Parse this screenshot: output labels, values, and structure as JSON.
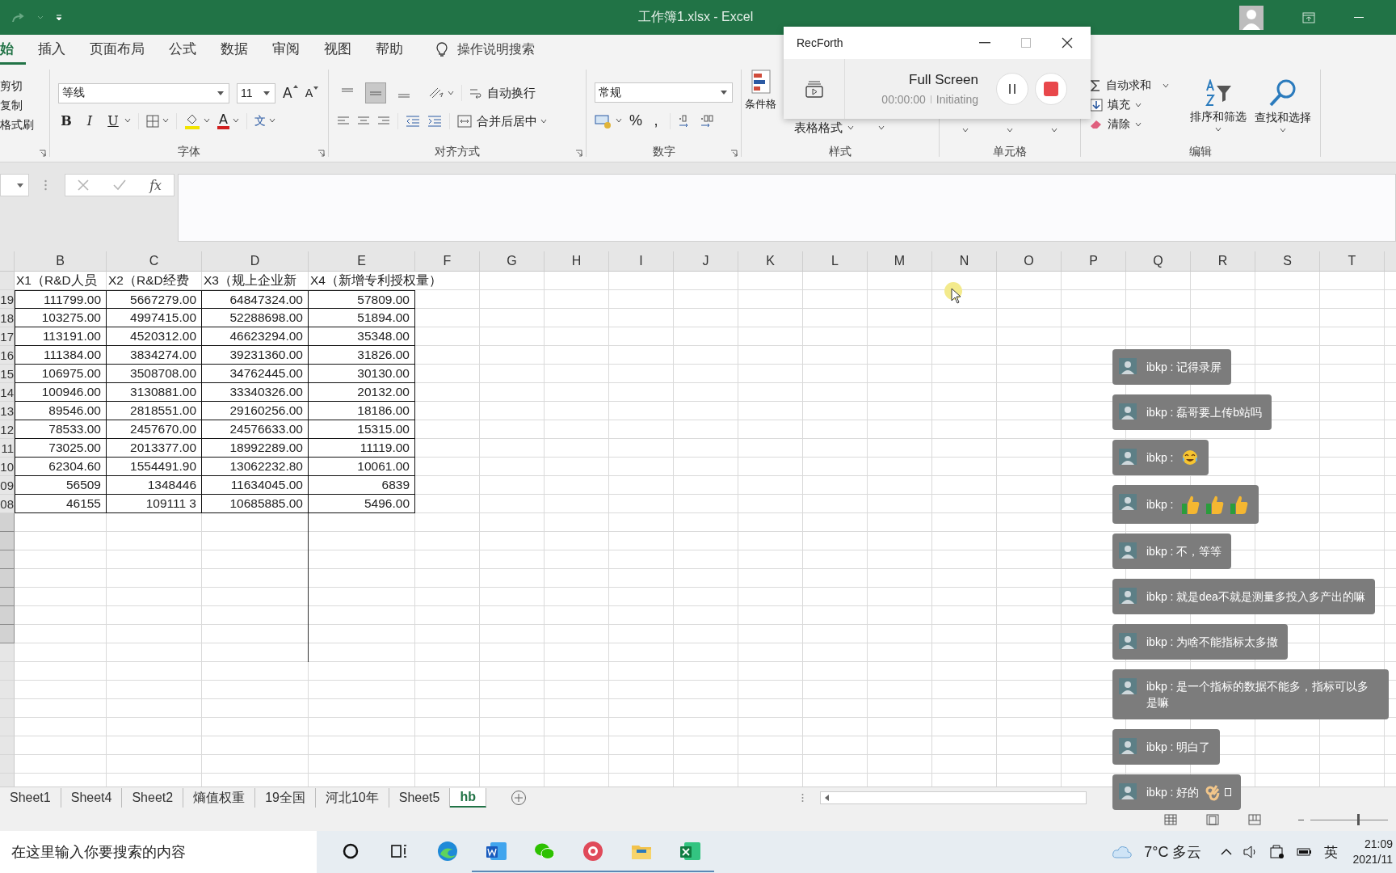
{
  "window": {
    "title": "工作簿1.xlsx  -  Excel"
  },
  "ribbon_tabs": [
    {
      "label": "始",
      "selected": true
    },
    {
      "label": "插入",
      "selected": false
    },
    {
      "label": "页面布局",
      "selected": false
    },
    {
      "label": "公式",
      "selected": false
    },
    {
      "label": "数据",
      "selected": false
    },
    {
      "label": "审阅",
      "selected": false
    },
    {
      "label": "视图",
      "selected": false
    },
    {
      "label": "帮助",
      "selected": false
    }
  ],
  "tell_me": "操作说明搜索",
  "clipboard": [
    "剪切",
    "复制",
    "格式刷"
  ],
  "font": {
    "name": "等线",
    "size": "11",
    "grow": "A",
    "shrink": "A",
    "bold": "B",
    "italic": "I",
    "underline": "U",
    "color_letter": "A",
    "phonetic": "文",
    "group_label": "字体"
  },
  "alignment": {
    "vertical": [
      {
        "kind": "top",
        "selected": false
      },
      {
        "kind": "middle",
        "selected": true
      },
      {
        "kind": "bottom",
        "selected": false
      }
    ],
    "wrap": "自动换行",
    "merge": "合并后居中",
    "group_label": "对齐方式"
  },
  "number": {
    "format": "常规",
    "percent": "%",
    "comma": ",",
    "group_label": "数字"
  },
  "styles": {
    "conditional": "条件格",
    "table": "表格格式",
    "group_label": "样式"
  },
  "cells_group": {
    "group_label": "单元格"
  },
  "editing": {
    "autosum": "自动求和",
    "fill": "填充",
    "clear": "清除",
    "sort": "排序和筛选",
    "find": "查找和选择",
    "group_label": "编辑"
  },
  "formula_bar": {
    "function_label": "fx"
  },
  "columns": [
    "B",
    "C",
    "D",
    "E",
    "F",
    "G",
    "H",
    "I",
    "J",
    "K",
    "L",
    "M",
    "N",
    "O",
    "P",
    "Q",
    "R",
    "S",
    "T"
  ],
  "header_row": [
    "X1（R&D人员",
    "X2（R&D经费",
    "X3（规上企业新",
    "X4（新增专利授权量）"
  ],
  "rows": [
    {
      "label": "19",
      "cells": [
        "111799.00",
        "5667279.00",
        "64847324.00",
        "57809.00"
      ]
    },
    {
      "label": "18",
      "cells": [
        "103275.00",
        "4997415.00",
        "52288698.00",
        "51894.00"
      ]
    },
    {
      "label": "17",
      "cells": [
        "113191.00",
        "4520312.00",
        "46623294.00",
        "35348.00"
      ]
    },
    {
      "label": "16",
      "cells": [
        "111384.00",
        "3834274.00",
        "39231360.00",
        "31826.00"
      ]
    },
    {
      "label": "15",
      "cells": [
        "106975.00",
        "3508708.00",
        "34762445.00",
        "30130.00"
      ]
    },
    {
      "label": "14",
      "cells": [
        "100946.00",
        "3130881.00",
        "33340326.00",
        "20132.00"
      ]
    },
    {
      "label": "13",
      "cells": [
        "89546.00",
        "2818551.00",
        "29160256.00",
        "18186.00"
      ]
    },
    {
      "label": "12",
      "cells": [
        "78533.00",
        "2457670.00",
        "24576633.00",
        "15315.00"
      ]
    },
    {
      "label": "11",
      "cells": [
        "73025.00",
        "2013377.00",
        "18992289.00",
        "11119.00"
      ]
    },
    {
      "label": "10",
      "cells": [
        "62304.60",
        "1554491.90",
        "13062232.80",
        "10061.00"
      ]
    },
    {
      "label": "09",
      "cells": [
        "56509",
        "1348446",
        "11634045.00",
        "6839"
      ]
    },
    {
      "label": "08",
      "cells": [
        "46155",
        "109111 3",
        "10685885.00",
        "5496.00"
      ]
    }
  ],
  "empty_rows": [
    {
      "selected": true
    },
    {
      "selected": true
    },
    {
      "selected": true
    },
    {
      "selected": true
    },
    {
      "selected": true
    },
    {
      "selected": true
    },
    {
      "selected": true
    },
    {
      "selected": false
    },
    {
      "selected": false
    },
    {
      "selected": false
    },
    {
      "selected": false
    },
    {
      "selected": false
    },
    {
      "selected": false
    },
    {
      "selected": false
    },
    {
      "selected": false
    }
  ],
  "sheet_tabs": [
    {
      "label": "Sheet1",
      "selected": false
    },
    {
      "label": "Sheet4",
      "selected": false
    },
    {
      "label": "Sheet2",
      "selected": false
    },
    {
      "label": "熵值权重",
      "selected": false
    },
    {
      "label": "19全国",
      "selected": false
    },
    {
      "label": "河北10年",
      "selected": false
    },
    {
      "label": "Sheet5",
      "selected": false
    },
    {
      "label": "hb",
      "selected": true
    }
  ],
  "zoom": {
    "level": 0.6
  },
  "recorder": {
    "title": "RecForth",
    "mode": "Full Screen",
    "time": "00:00:00",
    "status": "Initiating"
  },
  "chat": [
    {
      "text": "ibkp : 记得录屏"
    },
    {
      "text": "ibkp : 磊哥要上传b站吗"
    },
    {
      "text": "ibkp : ",
      "emoji": [
        {
          "kind": "laugh"
        }
      ]
    },
    {
      "text": "ibkp : ",
      "emoji": [
        {
          "kind": "thumbs"
        },
        {
          "kind": "thumbs"
        },
        {
          "kind": "thumbs"
        }
      ]
    },
    {
      "text": "ibkp : 不，等等"
    },
    {
      "text": "ibkp : 就是dea不就是测量多投入多产出的嘛"
    },
    {
      "text": "ibkp : 为啥不能指标太多撒"
    },
    {
      "text": "ibkp : 是一个指标的数据不能多，指标可以多是嘛"
    },
    {
      "text": "ibkp : 明白了"
    },
    {
      "text": "ibkp : 好的",
      "emoji": [
        {
          "kind": "ok"
        },
        {
          "kind": "tofu"
        }
      ]
    }
  ],
  "taskbar": {
    "search_placeholder": "在这里输入你要搜索的内容",
    "apps": [
      {
        "kind": "cortana",
        "running": false
      },
      {
        "kind": "taskview",
        "running": false
      },
      {
        "kind": "edge",
        "running": false
      },
      {
        "kind": "word",
        "running": true
      },
      {
        "kind": "wechat",
        "running": true
      },
      {
        "kind": "recorder",
        "running": true
      },
      {
        "kind": "explorer",
        "running": true
      },
      {
        "kind": "excel",
        "running": true
      }
    ],
    "weather": "7°C 多云",
    "ime": "英",
    "time": "21:09",
    "date": "2021/11"
  }
}
